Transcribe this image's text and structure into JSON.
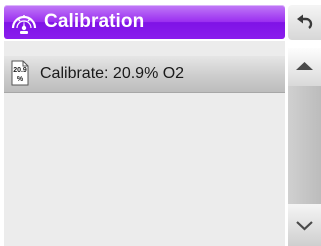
{
  "header": {
    "title": "Calibration",
    "icon": "gauge-icon",
    "accent": "#8a1ded"
  },
  "list": {
    "items": [
      {
        "label": "Calibrate: 20.9% O2",
        "icon": "o2-percent-icon",
        "icon_text_top": "20.9",
        "icon_text_bottom": "%"
      }
    ]
  },
  "controls": {
    "back_icon": "back-arrow-icon",
    "scroll_up_icon": "triangle-up-icon",
    "scroll_down_icon": "chevron-down-icon"
  }
}
